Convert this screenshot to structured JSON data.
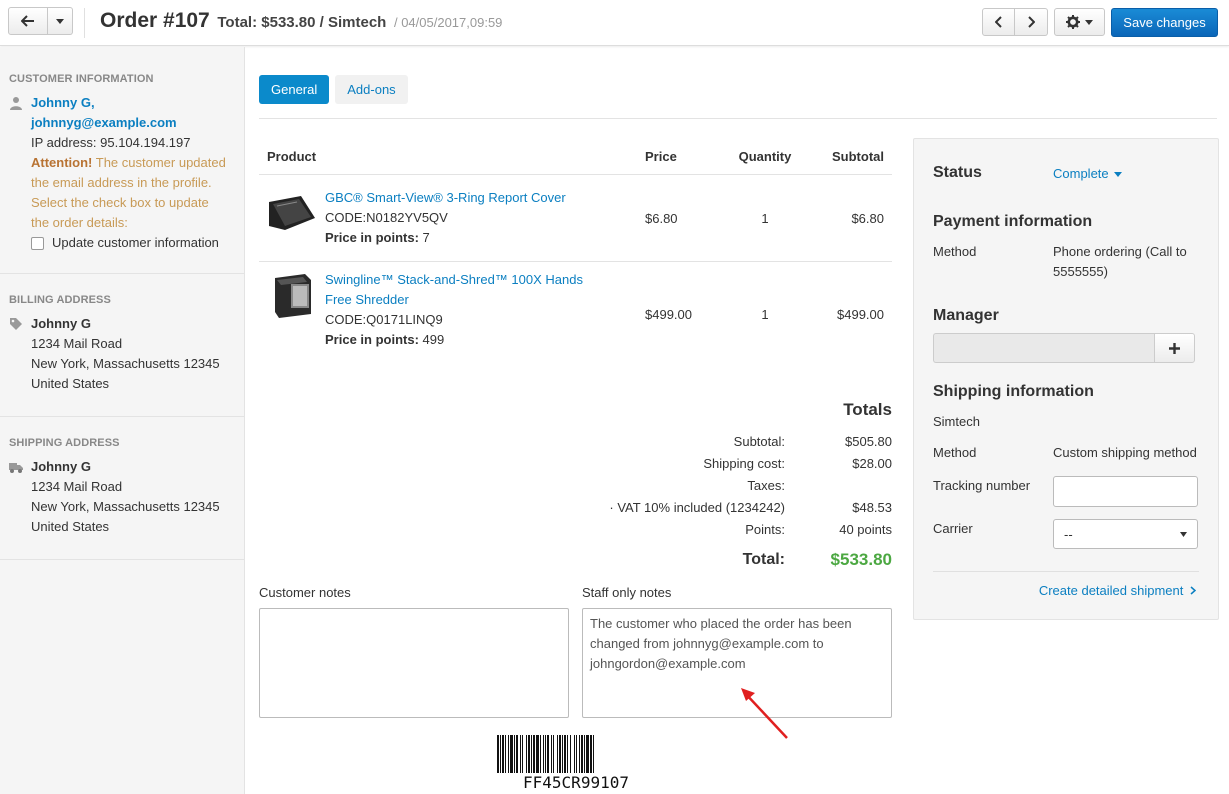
{
  "header": {
    "order_title": "Order #107",
    "total_text": "Total: $533.80 / Simtech",
    "date": "/ 04/05/2017,09:59",
    "save_label": "Save changes"
  },
  "sidebar": {
    "customer": {
      "heading": "Customer information",
      "name": "Johnny G,",
      "email": "johnnyg@example.com",
      "ip": "IP address: 95.104.194.197",
      "attention_bold": "Attention!",
      "attention_line1": "The customer updated",
      "attention_line2": "the email address in the profile.",
      "attention_line3": "Select the check box to update",
      "attention_line4": "the order details:",
      "checkbox_label": "Update customer information"
    },
    "billing": {
      "heading": "Billing address",
      "name": "Johnny G",
      "line1": "1234 Mail Road",
      "line2": "New York, Massachusetts 12345",
      "line3": "United States"
    },
    "shipping": {
      "heading": "Shipping address",
      "name": "Johnny G",
      "line1": "1234 Mail Road",
      "line2": "New York, Massachusetts 12345",
      "line3": "United States"
    }
  },
  "tabs": [
    {
      "label": "General",
      "active": true
    },
    {
      "label": "Add-ons",
      "active": false
    }
  ],
  "products": {
    "headers": {
      "product": "Product",
      "price": "Price",
      "quantity": "Quantity",
      "subtotal": "Subtotal"
    },
    "rows": [
      {
        "name": "GBC® Smart-View® 3-Ring Report Cover",
        "code": "CODE:N0182YV5QV",
        "points_label": "Price in points:",
        "points": "7",
        "price": "$6.80",
        "qty": "1",
        "subtotal": "$6.80"
      },
      {
        "name_line1": "Swingline™ Stack-and-Shred™ 100X Hands",
        "name_line2": "Free Shredder",
        "code": "CODE:Q0171LINQ9",
        "points_label": "Price in points:",
        "points": "499",
        "price": "$499.00",
        "qty": "1",
        "subtotal": "$499.00"
      }
    ]
  },
  "totals": {
    "heading": "Totals",
    "subtotal_label": "Subtotal:",
    "subtotal": "$505.80",
    "shipping_label": "Shipping cost:",
    "shipping": "$28.00",
    "taxes_label": "Taxes:",
    "vat_label": "· VAT 10% included (1234242)",
    "vat": "$48.53",
    "points_label": "Points:",
    "points": "40 points",
    "total_label": "Total:",
    "total": "$533.80"
  },
  "notes": {
    "customer_label": "Customer notes",
    "customer_value": "",
    "staff_label": "Staff only notes",
    "staff_line1": "The customer who placed the order has been",
    "staff_line2": "changed from johnnyg@example.com to",
    "staff_line3": "johngordon@example.com"
  },
  "barcode": "FF45CR99107",
  "panel": {
    "status_title": "Status",
    "status_value": "Complete",
    "payment_title": "Payment information",
    "method_label": "Method",
    "payment_method_line1": "Phone ordering (Call to",
    "payment_method_line2": "5555555)",
    "manager_title": "Manager",
    "shipping_title": "Shipping information",
    "shipping_company": "Simtech",
    "shipping_method_label": "Method",
    "shipping_method": "Custom shipping method",
    "tracking_label": "Tracking number",
    "tracking_value": "",
    "carrier_label": "Carrier",
    "carrier_value": "--",
    "create_shipment": "Create detailed shipment"
  },
  "colors": {
    "accent": "#0b8acb",
    "link": "#0b7fc1",
    "total_green": "#4ca842",
    "warning": "#c89a56",
    "annotation_arrow": "#e02020"
  }
}
